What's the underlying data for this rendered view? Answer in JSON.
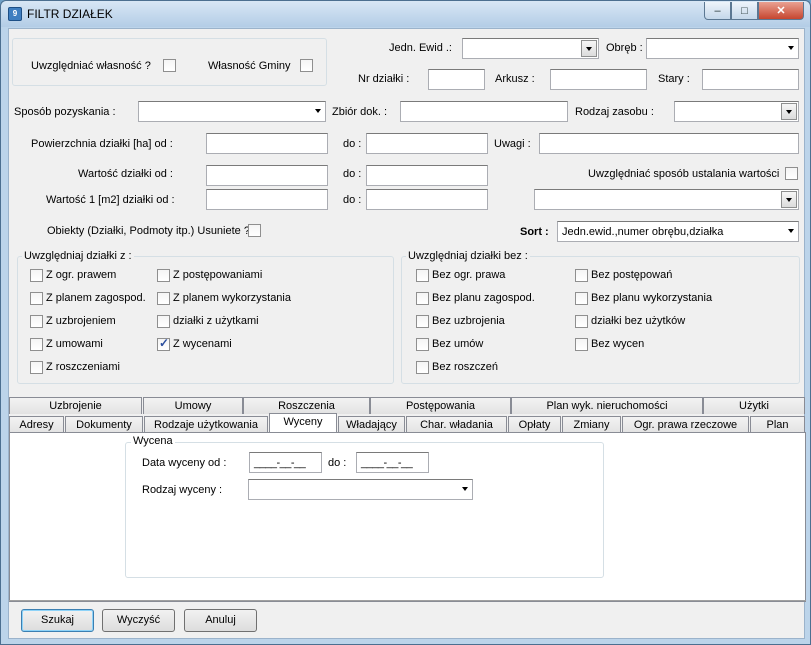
{
  "window": {
    "title": "FILTR DZIAŁEK",
    "icon": "app-icon",
    "buttons": {
      "minimize": "–",
      "maximize": "□",
      "close": "✕"
    }
  },
  "ownership": {
    "include_label": "Uwzględniać własność ?",
    "include_checked": false,
    "gmina_label": "Własność Gminy",
    "gmina_checked": false
  },
  "top": {
    "jedn_ewid_label": "Jedn. Ewid .:",
    "jedn_ewid_value": "",
    "obreb_label": "Obręb :",
    "obreb_value": "",
    "nr_dzialki_label": "Nr działki :",
    "nr_dzialki_value": "",
    "arkusz_label": "Arkusz :",
    "arkusz_value": "",
    "stary_label": "Stary :",
    "stary_value": "",
    "sposob_label": "Sposób pozyskania :",
    "sposob_value": "",
    "zbior_label": "Zbiór dok. :",
    "zbior_value": "",
    "rodzaj_zasobu_label": "Rodzaj zasobu :",
    "rodzaj_zasobu_value": "",
    "pow_label": "Powierzchnia działki [ha]  od :",
    "pow_od": "",
    "do_label": "do :",
    "pow_do": "",
    "uwagi_label": "Uwagi :",
    "uwagi_value": "",
    "wartosc_label": "Wartość działki od :",
    "wartosc_od": "",
    "wartosc_do": "",
    "ustalanie_label": "Uwzględniać sposób ustalania wartości",
    "ustalanie_checked": false,
    "wartosc1_label": "Wartość 1 [m2] działki od :",
    "wartosc1_od": "",
    "wartosc1_do": "",
    "sposob_ustalania_value": "",
    "usuniete_label": "Obiekty (Działki, Podmoty itp.) Usuniete ?",
    "usuniete_checked": false,
    "sort_label": "Sort :",
    "sort_value": "Jedn.ewid.,numer obrębu,działka"
  },
  "include_group": {
    "title": "Uwzględniaj działki z :",
    "items": [
      {
        "label": "Z ogr. prawem",
        "checked": false
      },
      {
        "label": "Z planem zagospod.",
        "checked": false
      },
      {
        "label": "Z uzbrojeniem",
        "checked": false
      },
      {
        "label": "Z umowami",
        "checked": false
      },
      {
        "label": "Z roszczeniami",
        "checked": false
      },
      {
        "label": "Z postępowaniami",
        "checked": false
      },
      {
        "label": "Z planem wykorzystania",
        "checked": false
      },
      {
        "label": "działki z użytkami",
        "checked": false
      },
      {
        "label": "Z wycenami",
        "checked": true
      }
    ]
  },
  "exclude_group": {
    "title": "Uwzględniaj działki bez :",
    "items": [
      {
        "label": "Bez ogr. prawa",
        "checked": false
      },
      {
        "label": "Bez planu zagospod.",
        "checked": false
      },
      {
        "label": "Bez uzbrojenia",
        "checked": false
      },
      {
        "label": "Bez umów",
        "checked": false
      },
      {
        "label": "Bez roszczeń",
        "checked": false
      },
      {
        "label": "Bez postępowań",
        "checked": false
      },
      {
        "label": "Bez planu wykorzystania",
        "checked": false
      },
      {
        "label": "działki bez użytków",
        "checked": false
      },
      {
        "label": "Bez wycen",
        "checked": false
      }
    ]
  },
  "tabs": {
    "row1": [
      "Uzbrojenie",
      "Umowy",
      "Roszczenia",
      "Postępowania",
      "Plan wyk. nieruchomości",
      "Użytki"
    ],
    "row2": [
      "Adresy",
      "Dokumenty",
      "Rodzaje użytkowania",
      "Wyceny",
      "Władający",
      "Char. władania",
      "Opłaty",
      "Zmiany",
      "Ogr. prawa rzeczowe",
      "Plan"
    ],
    "selected": "Wyceny"
  },
  "wycena": {
    "group_title": "Wycena",
    "data_label": "Data wyceny od :",
    "data_od": "____-__-__",
    "do_label": "do :",
    "data_do": "____-__-__",
    "rodzaj_label": "Rodzaj wyceny :",
    "rodzaj_value": ""
  },
  "buttons": {
    "search": "Szukaj",
    "clear": "Wyczyść",
    "cancel": "Anuluj"
  }
}
